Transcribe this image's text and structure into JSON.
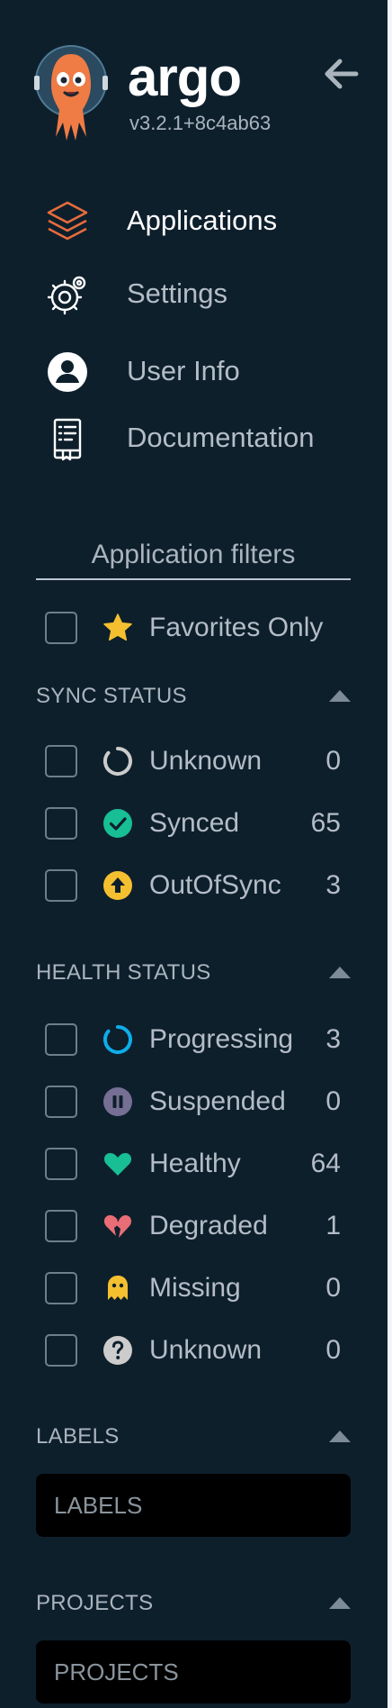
{
  "app": {
    "name": "argo",
    "version": "v3.2.1+8c4ab63"
  },
  "nav": [
    {
      "label": "Applications",
      "icon": "layers-icon",
      "active": true
    },
    {
      "label": "Settings",
      "icon": "gear-icon",
      "active": false
    },
    {
      "label": "User Info",
      "icon": "user-icon",
      "active": false
    },
    {
      "label": "Documentation",
      "icon": "book-icon",
      "active": false
    }
  ],
  "filters": {
    "title": "Application filters",
    "favorites_label": "Favorites Only",
    "sync": {
      "title": "SYNC STATUS",
      "items": [
        {
          "label": "Unknown",
          "count": "0"
        },
        {
          "label": "Synced",
          "count": "65"
        },
        {
          "label": "OutOfSync",
          "count": "3"
        }
      ]
    },
    "health": {
      "title": "HEALTH STATUS",
      "items": [
        {
          "label": "Progressing",
          "count": "3"
        },
        {
          "label": "Suspended",
          "count": "0"
        },
        {
          "label": "Healthy",
          "count": "64"
        },
        {
          "label": "Degraded",
          "count": "1"
        },
        {
          "label": "Missing",
          "count": "0"
        },
        {
          "label": "Unknown",
          "count": "0"
        }
      ]
    },
    "labels": {
      "title": "LABELS",
      "placeholder": "LABELS"
    },
    "projects": {
      "title": "PROJECTS",
      "placeholder": "PROJECTS"
    }
  },
  "colors": {
    "sidebar_bg": "#0e1f2c",
    "synced": "#18be94",
    "out_of_sync": "#f4c030",
    "progressing": "#0dadea",
    "suspended": "#766f94",
    "healthy": "#18be94",
    "degraded": "#e96d76",
    "missing": "#f4c030",
    "unknown": "#cccccc",
    "accent": "#e96d3c"
  }
}
